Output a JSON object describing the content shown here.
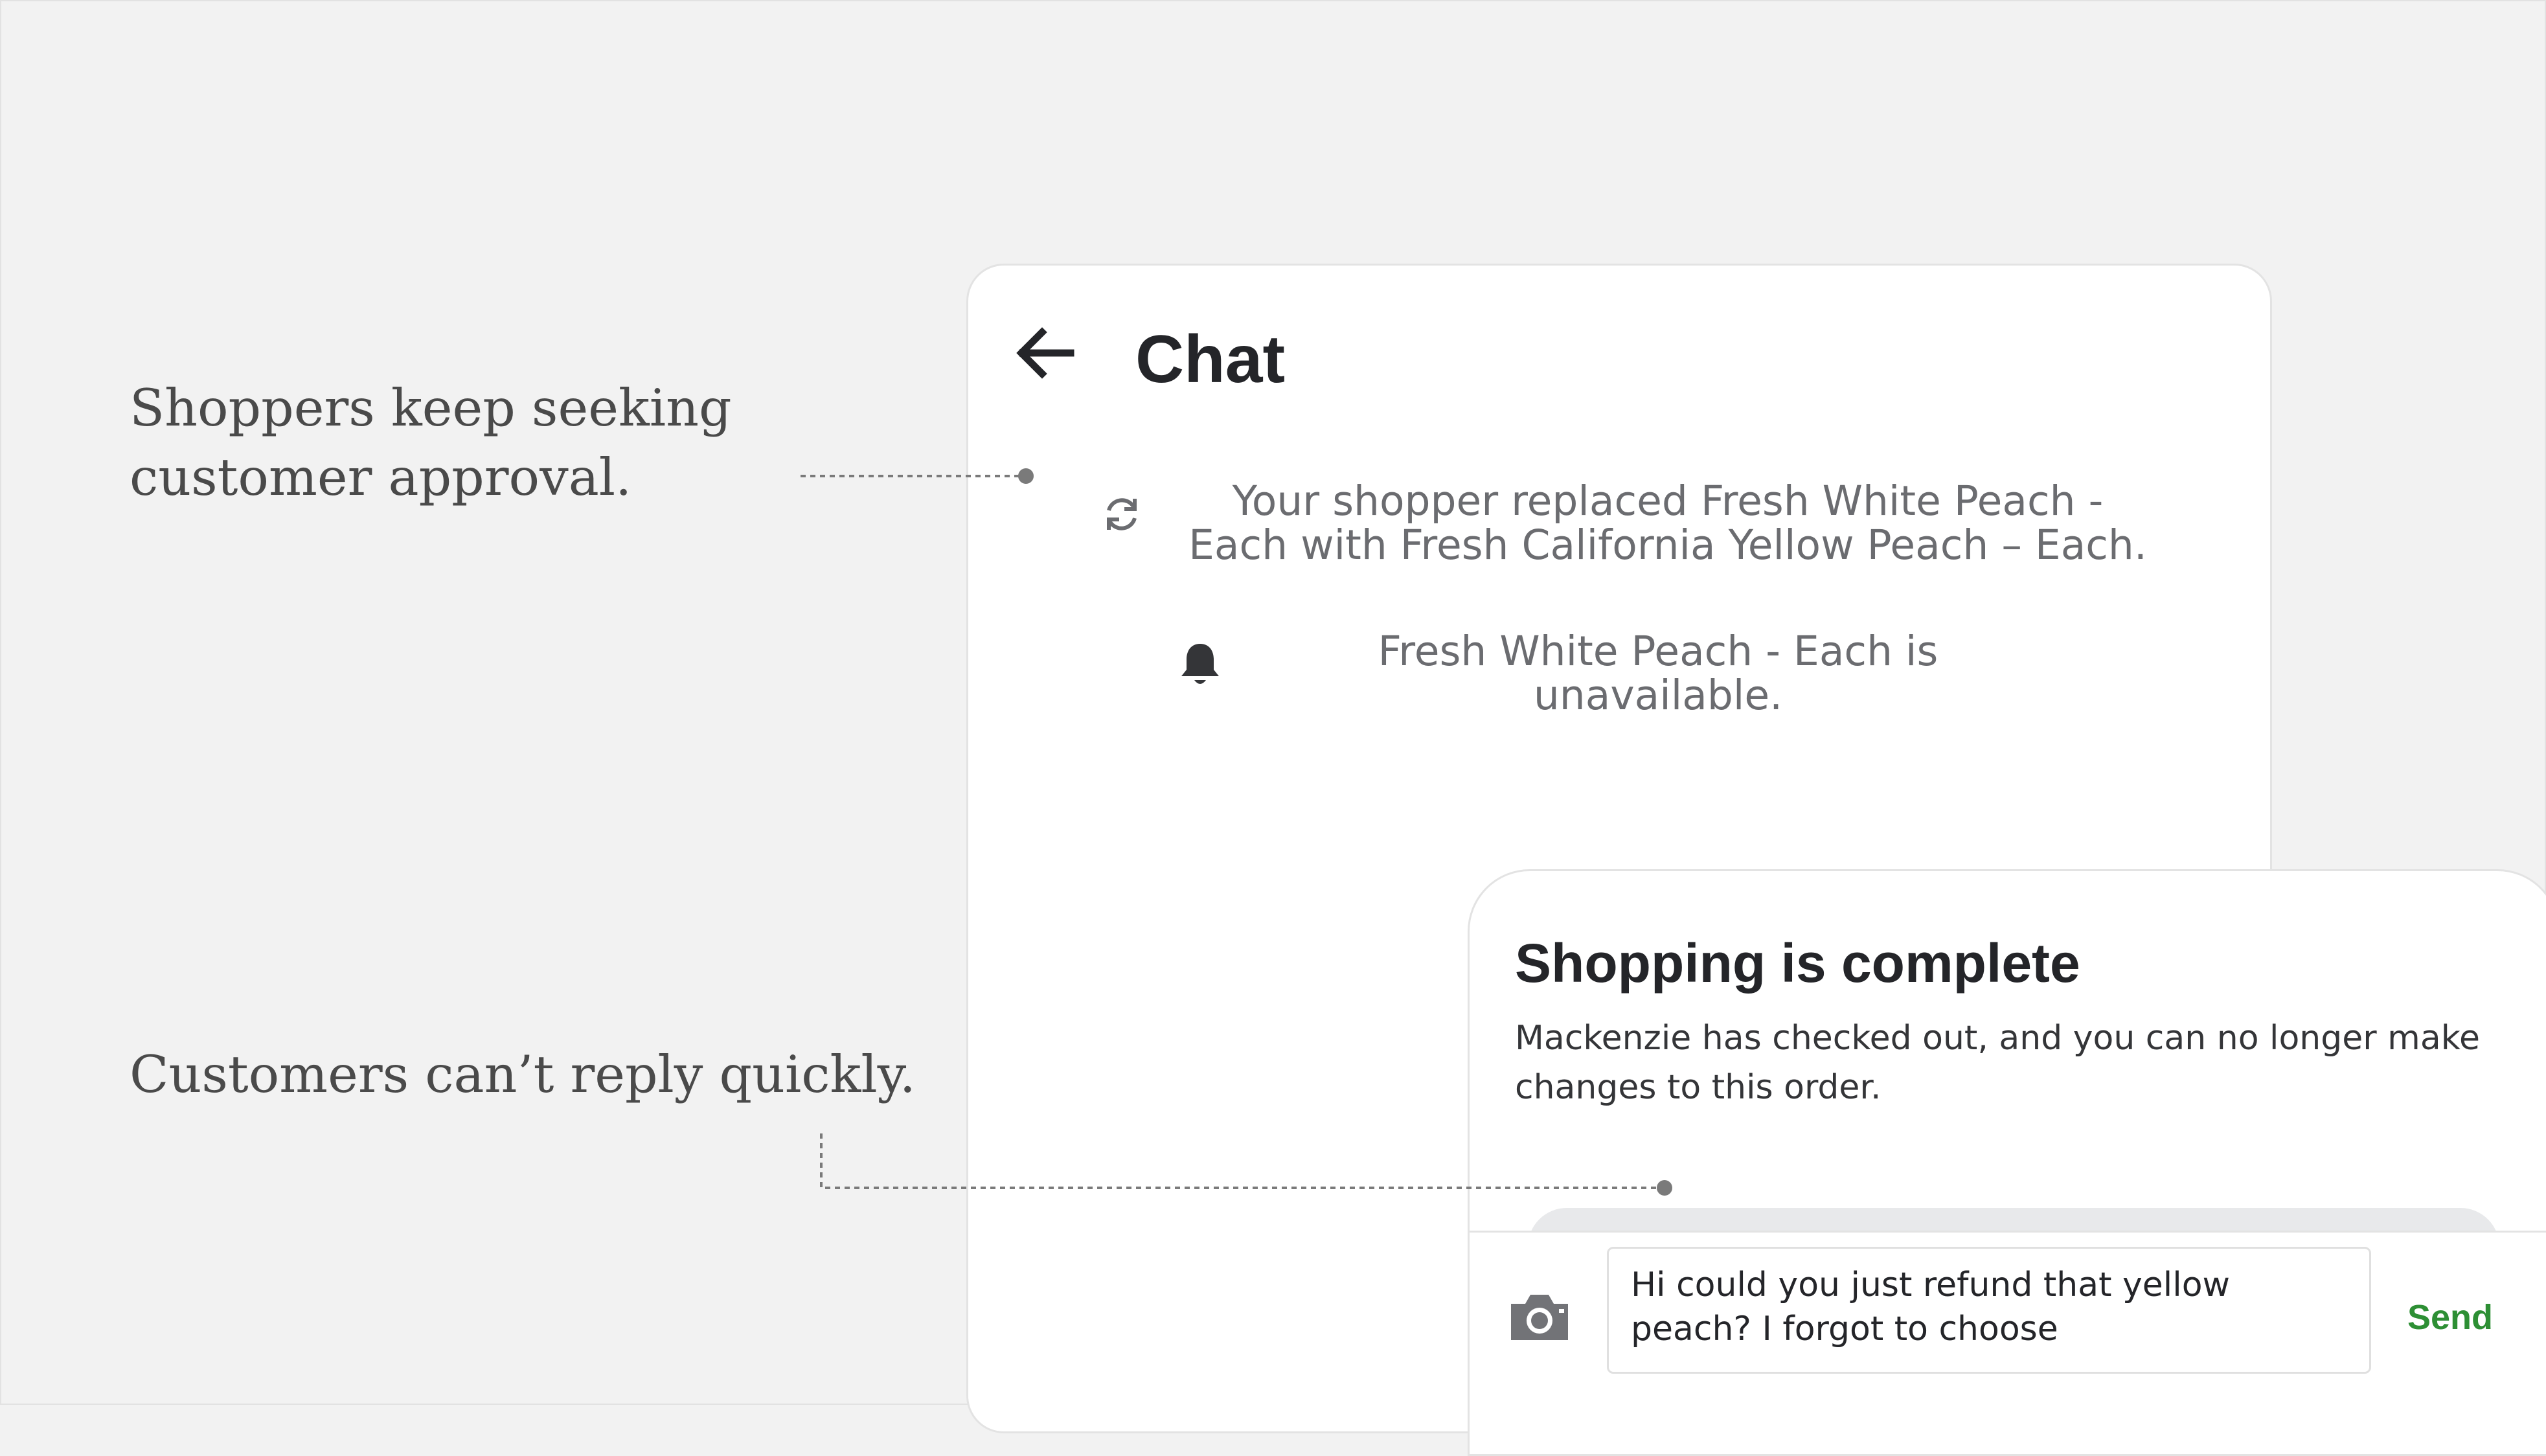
{
  "annotations": {
    "approval": "Shoppers keep seeking customer approval.",
    "reply": "Customers can’t reply quickly."
  },
  "chat": {
    "title": "Chat",
    "back_icon": "arrow-left-icon",
    "messages": [
      {
        "icon": "refresh-icon",
        "text": "Your shopper replaced Fresh White Peach - Each with Fresh California Yellow Peach – Each."
      },
      {
        "icon": "bell-icon",
        "text": "Fresh White Peach - Each is unavailable."
      }
    ]
  },
  "sheet": {
    "title": "Shopping is complete",
    "body": "Mackenzie has checked out, and you can no longer make changes to this order."
  },
  "composer": {
    "camera_icon": "camera-icon",
    "input_value": "Hi could you just refund that yellow peach? I forgot to choose",
    "send_label": "Send"
  },
  "colors": {
    "page_bg": "#f2f2f2",
    "card_bg": "#ffffff",
    "send": "#2d8f34",
    "annotation_text": "#4a4a4a",
    "connector": "#7a7a7a"
  }
}
